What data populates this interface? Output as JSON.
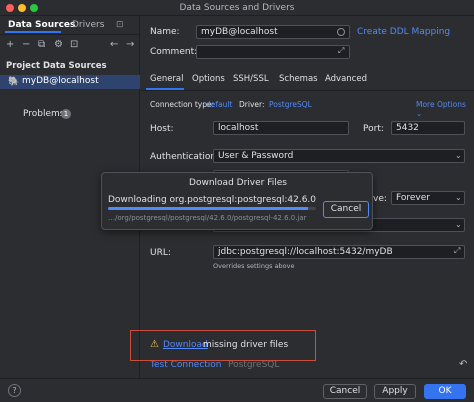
{
  "window": {
    "title": "Data Sources and Drivers"
  },
  "left": {
    "tabs": [
      "Data Sources",
      "Drivers",
      "⊡"
    ],
    "toolbar": [
      "+",
      "−",
      "⧉",
      "⚙",
      "⊡",
      "←",
      "→"
    ],
    "section": "Project Data Sources",
    "datasource": "myDB@localhost",
    "problems": {
      "label": "Problems",
      "count": "1"
    }
  },
  "main": {
    "name_label": "Name:",
    "name_value": "myDB@localhost",
    "create_ddl": "Create DDL Mapping",
    "comment_label": "Comment:",
    "tabs": [
      "General",
      "Options",
      "SSH/SSL",
      "Schemas",
      "Advanced"
    ],
    "conn_type_label": "Connection type:",
    "conn_type_value": "default",
    "driver_label": "Driver:",
    "driver_value": "PostgreSQL",
    "more_options": "More Options",
    "host_label": "Host:",
    "host_value": "localhost",
    "port_label": "Port:",
    "port_value": "5432",
    "auth_label": "Authentication:",
    "auth_value": "User & Password",
    "save_fragment": "ve:",
    "save_value": "Forever",
    "url_label": "URL:",
    "url_value": "jdbc:postgresql://localhost:5432/myDB",
    "url_note": "Overrides settings above",
    "test_connection": "Test Connection",
    "test_driver": "PostgreSQL"
  },
  "dialog": {
    "title": "Download Driver Files",
    "message": "Downloading org.postgresql:postgresql:42.6.0",
    "path": "…/org/postgresql/postgresql/42.6.0/postgresql-42.6.0.jar",
    "cancel": "Cancel",
    "progress": 0.96
  },
  "warning": {
    "link": "Download",
    "text": "missing driver files"
  },
  "footer": {
    "help": "?",
    "cancel": "Cancel",
    "apply": "Apply",
    "ok": "OK"
  },
  "colors": {
    "accent": "#3574f0",
    "link": "#548af7",
    "warning_border": "#c94f3c",
    "warning_icon": "#f2c55c"
  }
}
